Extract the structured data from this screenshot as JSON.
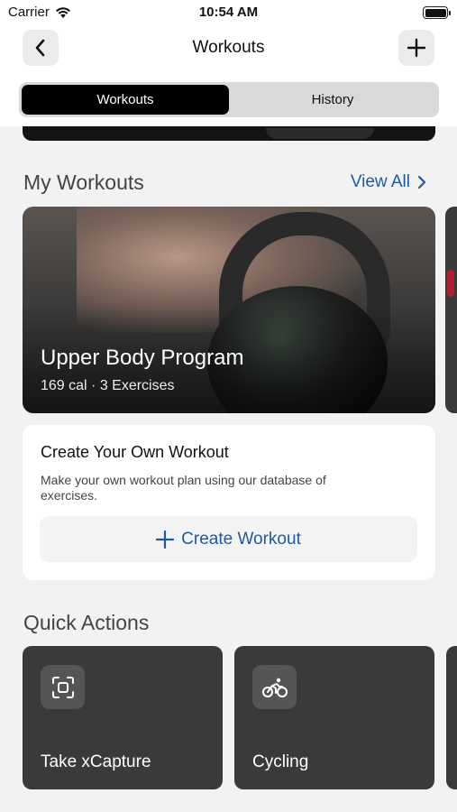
{
  "status_bar": {
    "carrier": "Carrier",
    "time": "10:54 AM",
    "wifi_icon": "wifi-icon",
    "battery_icon": "battery-icon"
  },
  "header": {
    "title": "Workouts",
    "back_icon": "chevron-left-icon",
    "add_icon": "plus-icon"
  },
  "tabs": [
    {
      "label": "Workouts",
      "active": true
    },
    {
      "label": "History",
      "active": false
    }
  ],
  "my_workouts": {
    "title": "My Workouts",
    "view_all_label": "View All",
    "cards": [
      {
        "title": "Upper Body Program",
        "subtitle": "169 cal · 3 Exercises"
      }
    ]
  },
  "create_workout": {
    "title": "Create Your Own Workout",
    "description": "Make your own workout plan using our database of exercises.",
    "button_label": "Create Workout",
    "button_icon": "plus-icon"
  },
  "quick_actions": {
    "title": "Quick Actions",
    "items": [
      {
        "label": "Take xCapture",
        "icon": "scan-icon"
      },
      {
        "label": "Cycling",
        "icon": "cycling-icon"
      }
    ]
  },
  "colors": {
    "accent": "#1e5a9c",
    "background": "#f2f2f2",
    "card_dark": "#3a3a3a"
  }
}
